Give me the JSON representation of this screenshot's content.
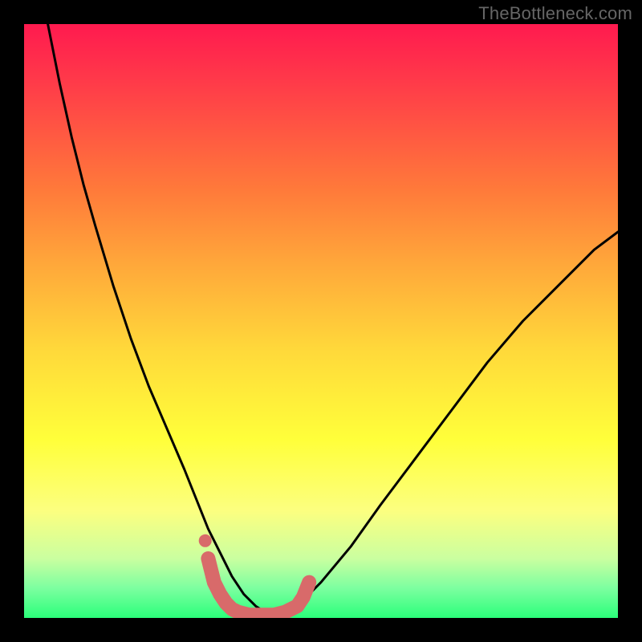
{
  "watermark": "TheBottleneck.com",
  "chart_data": {
    "type": "line",
    "title": "",
    "xlabel": "",
    "ylabel": "",
    "xlim": [
      0,
      100
    ],
    "ylim": [
      0,
      100
    ],
    "grid": false,
    "legend": false,
    "series": [
      {
        "name": "bottleneck-curve",
        "color": "#000000",
        "x": [
          4,
          6,
          8,
          10,
          12,
          15,
          18,
          21,
          24,
          27,
          29,
          31,
          33,
          35,
          37,
          39,
          42,
          46,
          50,
          55,
          60,
          66,
          72,
          78,
          84,
          90,
          96,
          100
        ],
        "values": [
          100,
          90,
          81,
          73,
          66,
          56,
          47,
          39,
          32,
          25,
          20,
          15,
          11,
          7,
          4,
          2,
          0,
          2,
          6,
          12,
          19,
          27,
          35,
          43,
          50,
          56,
          62,
          65
        ]
      },
      {
        "name": "highlight-min",
        "color": "#d86a6a",
        "x": [
          31,
          32,
          33,
          34,
          35,
          36,
          38,
          40,
          42,
          44,
          46,
          47,
          48
        ],
        "values": [
          10,
          6,
          4,
          2.5,
          1.5,
          1,
          0.5,
          0.5,
          0.5,
          1,
          2,
          3.5,
          6
        ]
      },
      {
        "name": "highlight-dot",
        "color": "#d86a6a",
        "style": "dot",
        "x": [
          30.5
        ],
        "values": [
          13
        ]
      }
    ],
    "gradient_stops": [
      {
        "pos": 0,
        "color": "#ff1a4f"
      },
      {
        "pos": 28,
        "color": "#ff7a3a"
      },
      {
        "pos": 55,
        "color": "#ffd93a"
      },
      {
        "pos": 82,
        "color": "#fcff80"
      },
      {
        "pos": 95,
        "color": "#7cffa0"
      },
      {
        "pos": 100,
        "color": "#2bff7a"
      }
    ]
  }
}
